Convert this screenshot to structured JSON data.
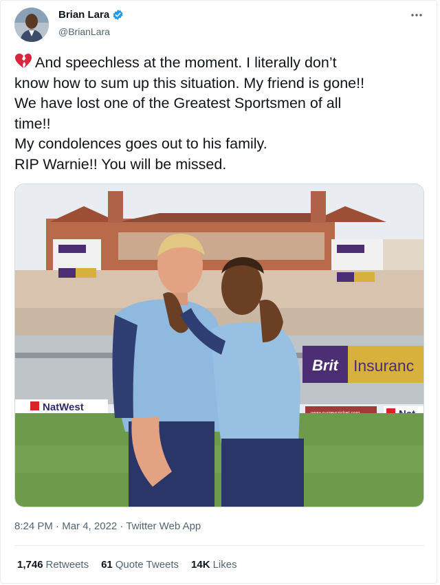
{
  "user": {
    "display_name": "Brian Lara",
    "handle": "@BrianLara",
    "verified_icon": "verified-badge-icon",
    "avatar_icon": "avatar"
  },
  "more_icon": "more-icon",
  "tweet": {
    "emoji": "broken-heart-icon",
    "text": "And speechless at the moment. I literally don’t\nknow how to sum up this situation. My friend is gone!!\nWe have lost one of the Greatest Sportsmen of all\ntime!!\nMy condolences goes out to his family.\nRIP Warnie!! You will be missed."
  },
  "media": {
    "banner_brit_word": "Brit",
    "banner_insurance_word": "Insuranc",
    "natwest_word": "NatWest",
    "nat_word": "Nat",
    "small_board_text": "www.surreycricket.com"
  },
  "meta": {
    "time": "8:24 PM",
    "separator": " · ",
    "date": "Mar 4, 2022",
    "source": "Twitter Web App"
  },
  "stats": {
    "retweets_count": "1,746",
    "retweets_label": "Retweets",
    "quotes_count": "61",
    "quotes_label": "Quote Tweets",
    "likes_count": "14K",
    "likes_label": "Likes"
  },
  "colors": {
    "verified": "#1d9bf0",
    "text": "#0f1419",
    "secondary": "#536471",
    "brit_banner": "#d8b13c",
    "brit_purple": "#4b2e73",
    "natwest_red": "#d8232a",
    "jersey": "#8fb9de"
  }
}
